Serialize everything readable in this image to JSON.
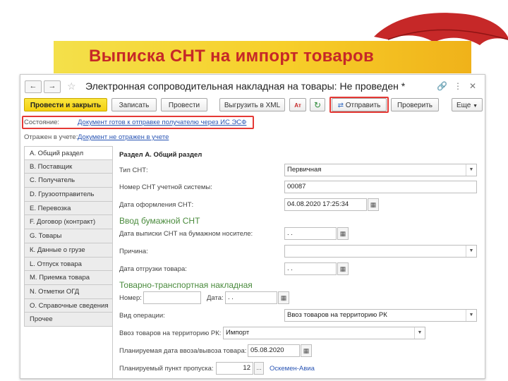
{
  "slide": {
    "title": "Выписка СНТ на импорт товаров"
  },
  "window": {
    "title": "Электронная сопроводительная накладная на товары: Не проведен *",
    "nav": {
      "back": "←",
      "forward": "→"
    },
    "title_icons": [
      "link-icon",
      "more-icon",
      "close-icon"
    ]
  },
  "toolbar": {
    "post_close": "Провести и закрыть",
    "save": "Записать",
    "post": "Провести",
    "export_xml": "Выгрузить в XML",
    "send": "Отправить",
    "check": "Проверить",
    "more": "Еще"
  },
  "status": {
    "state_label": "Состояние:",
    "state_value": "Документ готов к отправке получателю через ИС ЭСФ",
    "account_label": "Отражен в учете:",
    "account_value": "Документ не отражен в учете"
  },
  "tabs": [
    "А. Общий раздел",
    "В. Поставщик",
    "С. Получатель",
    "D. Грузоотправитель",
    "Е. Перевозка",
    "F. Договор (контракт)",
    "G. Товары",
    "К. Данные о грузе",
    "L. Отпуск товара",
    "М. Приемка товара",
    "N. Отметки ОГД",
    "O. Справочные сведения",
    "Прочее"
  ],
  "form": {
    "section_title": "Раздел А. Общий раздел",
    "snt_type_label": "Тип СНТ:",
    "snt_type_value": "Первичная",
    "snt_number_label": "Номер СНТ учетной системы:",
    "snt_number_value": "00087",
    "snt_date_label": "Дата оформления СНТ:",
    "snt_date_value": "04.08.2020 17:25:34",
    "paper_group": "Ввод бумажной СНТ",
    "paper_date_label": "Дата выписки СНТ на бумажном носителе:",
    "paper_date_value": " .  .",
    "reason_label": "Причина:",
    "reason_value": "",
    "ship_date_label": "Дата отгрузки товара:",
    "ship_date_value": " .  .",
    "ttn_group": "Товарно-транспортная накладная",
    "ttn_number_label": "Номер:",
    "ttn_number_value": "",
    "ttn_date_label": "Дата:",
    "ttn_date_value": " .  .",
    "operation_label": "Вид операции:",
    "operation_value": "Ввоз товаров на территорию РК",
    "import_label": "Ввоз товаров на территорию РК:",
    "import_value": "Импорт",
    "planned_date_label": "Планируемая дата ввоза/вывоза товара:",
    "planned_date_value": "05.08.2020",
    "checkpoint_label": "Планируемый пункт пропуска:",
    "checkpoint_code": "12",
    "checkpoint_name": "Оскемен-Авиа"
  }
}
